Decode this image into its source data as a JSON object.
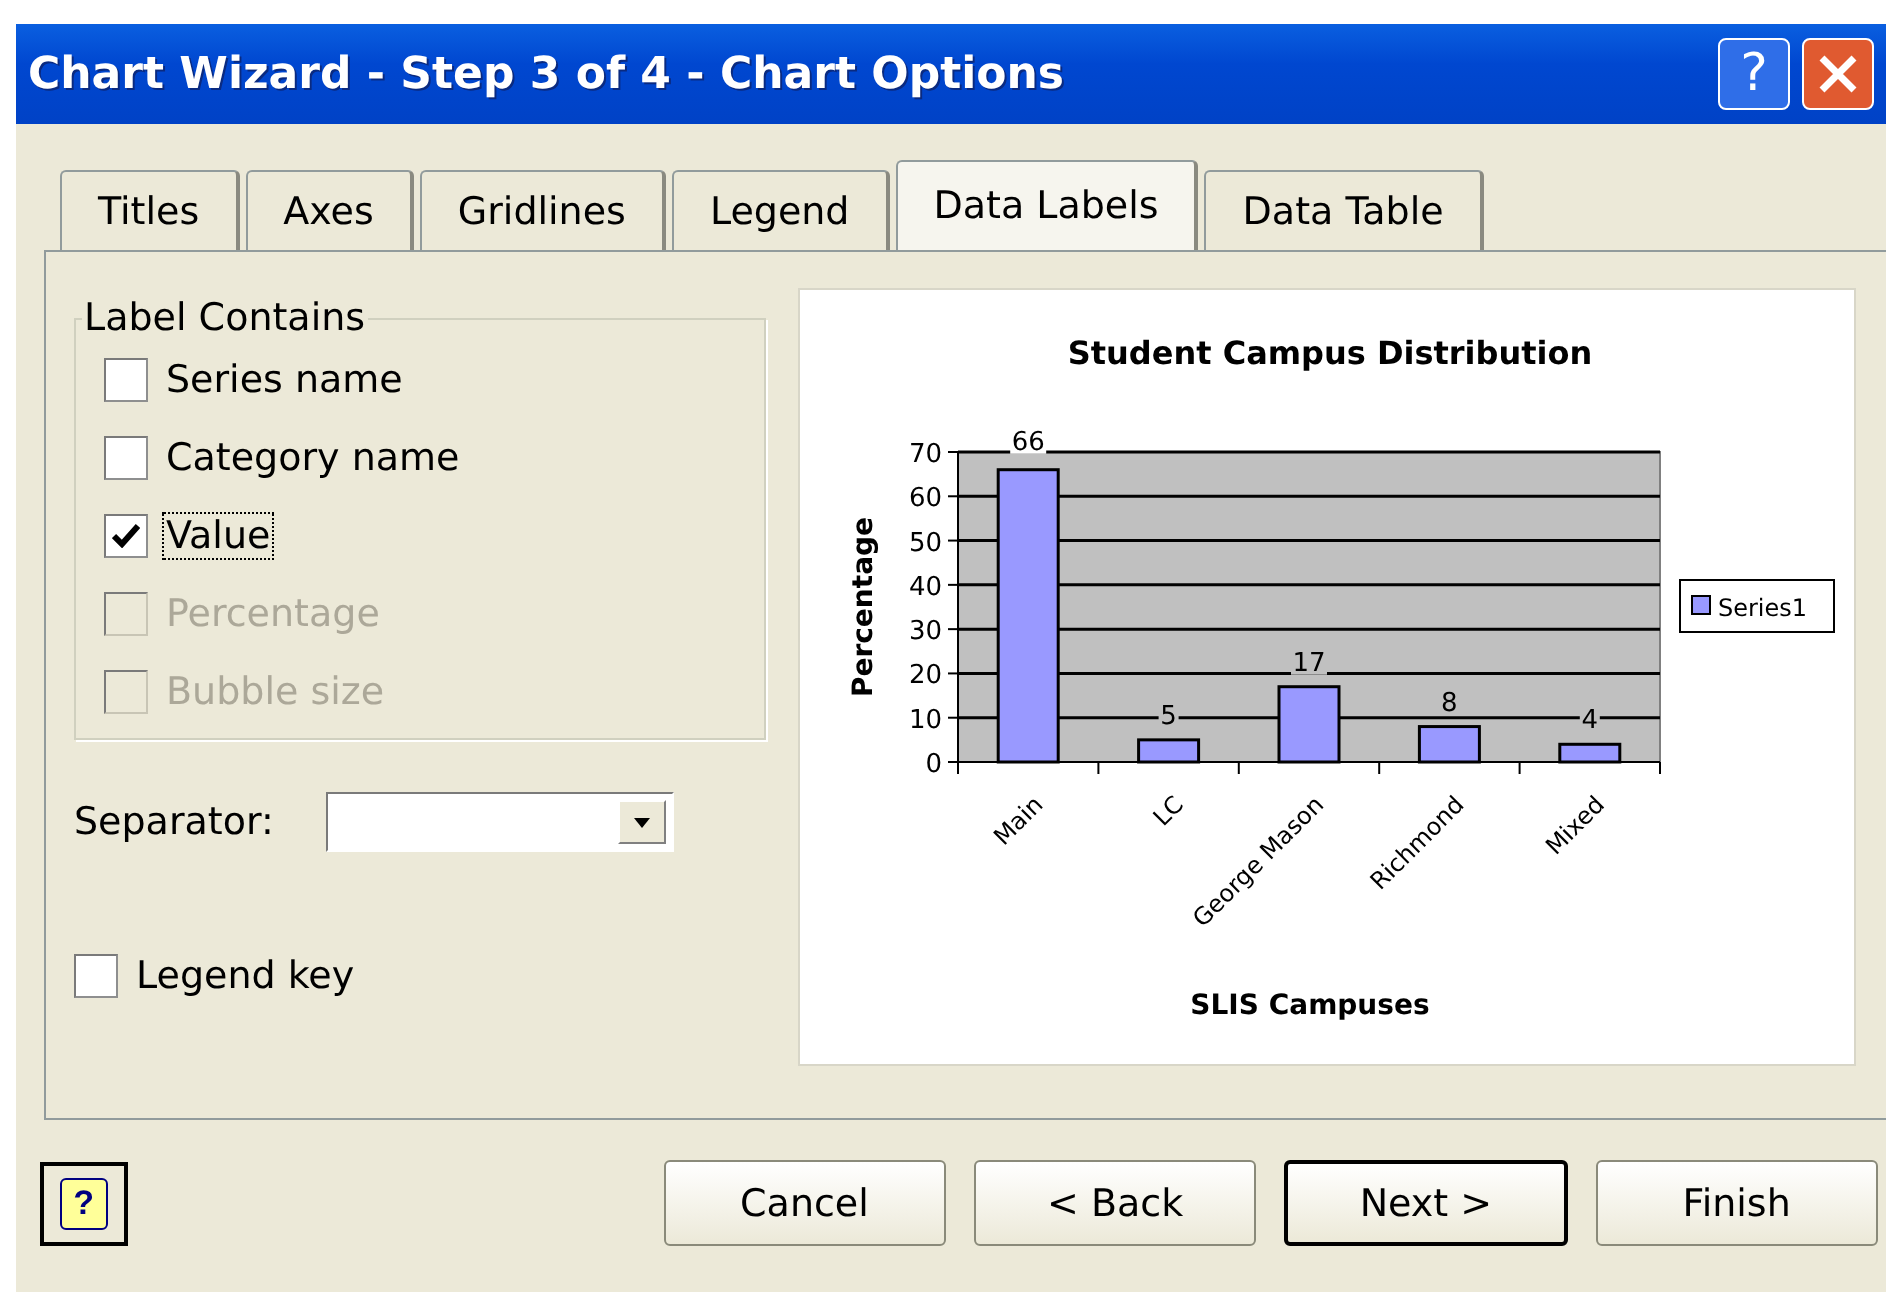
{
  "window": {
    "title": "Chart Wizard - Step 3 of 4 - Chart Options",
    "help_glyph": "?"
  },
  "tabs": [
    {
      "label": "Titles",
      "selected": false
    },
    {
      "label": "Axes",
      "selected": false
    },
    {
      "label": "Gridlines",
      "selected": false
    },
    {
      "label": "Legend",
      "selected": false
    },
    {
      "label": "Data Labels",
      "selected": true
    },
    {
      "label": "Data Table",
      "selected": false
    }
  ],
  "label_contains": {
    "title": "Label Contains",
    "options": [
      {
        "label": "Series name",
        "checked": false,
        "disabled": false,
        "focused": false
      },
      {
        "label": "Category name",
        "checked": false,
        "disabled": false,
        "focused": false
      },
      {
        "label": "Value",
        "checked": true,
        "disabled": false,
        "focused": true
      },
      {
        "label": "Percentage",
        "checked": false,
        "disabled": true,
        "focused": false
      },
      {
        "label": "Bubble size",
        "checked": false,
        "disabled": true,
        "focused": false
      }
    ]
  },
  "separator": {
    "label": "Separator:"
  },
  "legend_key": {
    "label": "Legend key",
    "checked": false
  },
  "preview": {
    "chart_data": {
      "type": "bar",
      "title": "Student Campus Distribution",
      "xlabel": "SLIS Campuses",
      "ylabel": "Percentage",
      "categories": [
        "Main",
        "LC",
        "George Mason",
        "Richmond",
        "Mixed"
      ],
      "series": [
        {
          "name": "Series1",
          "color": "#9999ff",
          "values": [
            66,
            5,
            17,
            8,
            4
          ]
        }
      ],
      "ylim": [
        0,
        70
      ],
      "grid": true,
      "yticks": [
        0,
        10,
        20,
        30,
        40,
        50,
        60,
        70
      ],
      "data_labels": true
    }
  },
  "help_button": {
    "label": "?"
  },
  "buttons": [
    {
      "label": "Cancel",
      "default": false
    },
    {
      "label": "< Back",
      "default": false
    },
    {
      "label": "Next >",
      "default": true
    },
    {
      "label": "Finish",
      "default": false
    }
  ]
}
